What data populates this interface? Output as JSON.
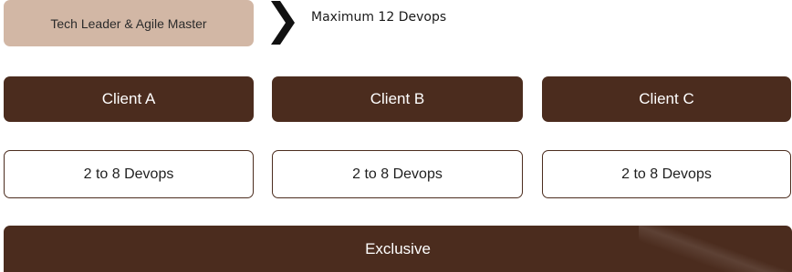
{
  "header": {
    "role_label": "Tech Leader & Agile Master",
    "max_label": "Maximum 12 Devops",
    "arrow_icon": "chevron-right-icon"
  },
  "clients": [
    {
      "name": "Client A",
      "devops": "2 to 8 Devops"
    },
    {
      "name": "Client B",
      "devops": "2 to 8 Devops"
    },
    {
      "name": "Client C",
      "devops": "2 to 8 Devops"
    }
  ],
  "footer": {
    "label": "Exclusive"
  },
  "colors": {
    "dark_brown": "#4b2c1e",
    "tan": "#d2b7a5",
    "text_dark": "#1f1f1f",
    "chevron": "#111111"
  }
}
